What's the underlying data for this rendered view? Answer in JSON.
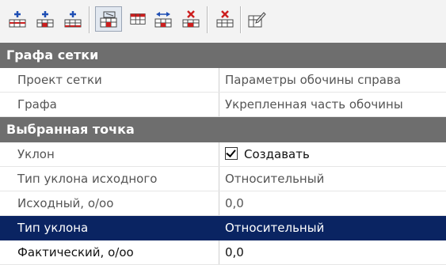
{
  "toolbar": {
    "buttons": [
      {
        "icon": "add-row-before-icon"
      },
      {
        "icon": "add-row-icon"
      },
      {
        "icon": "add-row-after-icon"
      },
      {
        "icon": "grid-properties-icon",
        "pressed": true
      },
      {
        "icon": "table-icon"
      },
      {
        "icon": "move-row-icon"
      },
      {
        "icon": "delete-row-icon"
      },
      {
        "icon": "delete-all-icon"
      },
      {
        "icon": "edit-icon"
      }
    ]
  },
  "categories": {
    "grid_column": "Графа сетки",
    "selected_point": "Выбранная точка"
  },
  "rows": {
    "grid_project": {
      "label": "Проект сетки",
      "value": "Параметры обочины справа"
    },
    "column": {
      "label": "Графа",
      "value": "Укрепленная часть обочины"
    },
    "slope": {
      "label": "Уклон",
      "value": "Создавать",
      "checked": true
    },
    "source_slope_type": {
      "label": "Тип уклона исходного",
      "value": "Относительный"
    },
    "source": {
      "label": "Исходный, о/оо",
      "value": "0,0"
    },
    "slope_type": {
      "label": "Тип уклона",
      "value": "Относительный"
    },
    "actual": {
      "label": "Фактический, о/оо",
      "value": "0,0"
    }
  },
  "colors": {
    "category_bg": "#6e6e6e",
    "selection_bg": "#0a2462",
    "icon_red": "#cc1f1f",
    "icon_blue": "#1f4fb4"
  }
}
